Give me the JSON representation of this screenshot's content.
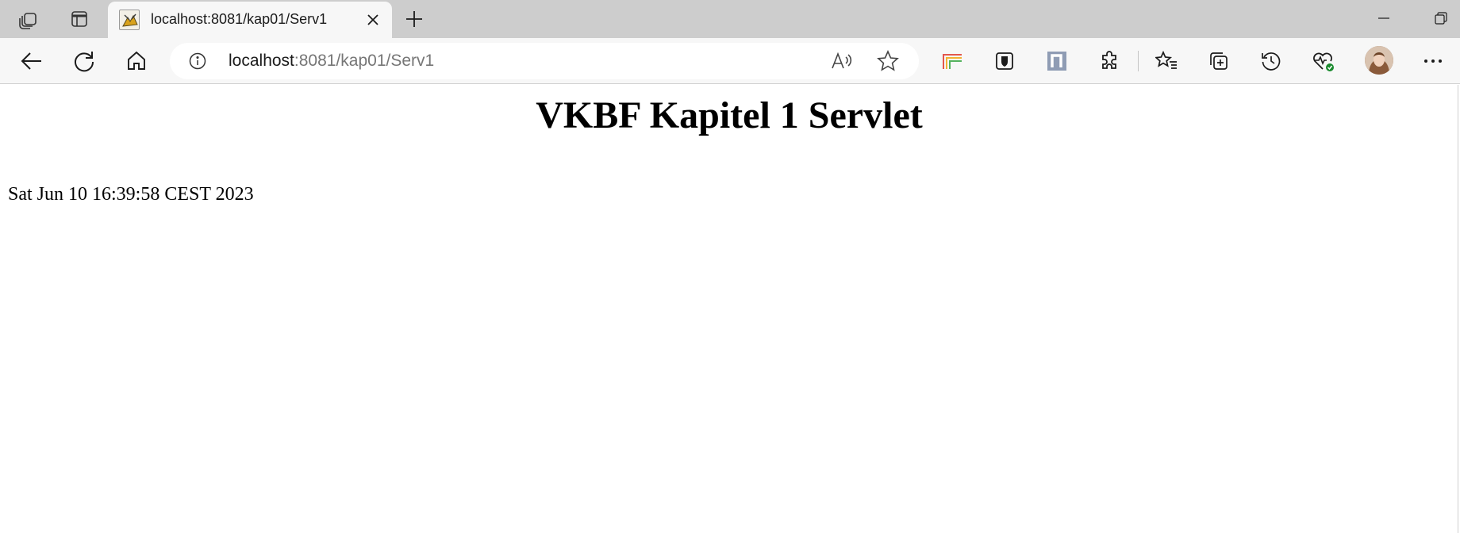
{
  "browser": {
    "tab": {
      "title": "localhost:8081/kap01/Serv1"
    },
    "address_bar": {
      "host": "localhost",
      "path": ":8081/kap01/Serv1"
    },
    "icons": {
      "workspaces": "workspaces-icon",
      "vertical_tabs": "vertical-tabs-icon",
      "tab_favicon": "tomcat-favicon-icon",
      "tab_close": "close-icon",
      "new_tab": "plus-icon",
      "minimize": "minimize-icon",
      "maximize": "maximize-icon",
      "back": "back-arrow-icon",
      "refresh": "refresh-icon",
      "home": "home-icon",
      "site_info": "info-icon",
      "read_aloud": "read-aloud-icon",
      "favorite": "star-icon",
      "extension_1": "multi-color-extension-icon",
      "extension_2": "bitwarden-extension-icon",
      "extension_3": "notion-extension-icon",
      "extensions": "puzzle-icon",
      "favorites": "favorites-list-icon",
      "collections": "collections-icon",
      "history": "history-icon",
      "browser_essentials": "heartbeat-icon",
      "profile": "profile-avatar",
      "more": "more-dots-icon"
    },
    "colors": {
      "tabstrip_bg": "#cdcdcd",
      "toolbar_bg": "#f7f7f7",
      "status_green": "#1a8a2e"
    }
  },
  "page": {
    "heading": "VKBF Kapitel 1 Servlet",
    "date": "Sat Jun 10 16:39:58 CEST 2023"
  }
}
